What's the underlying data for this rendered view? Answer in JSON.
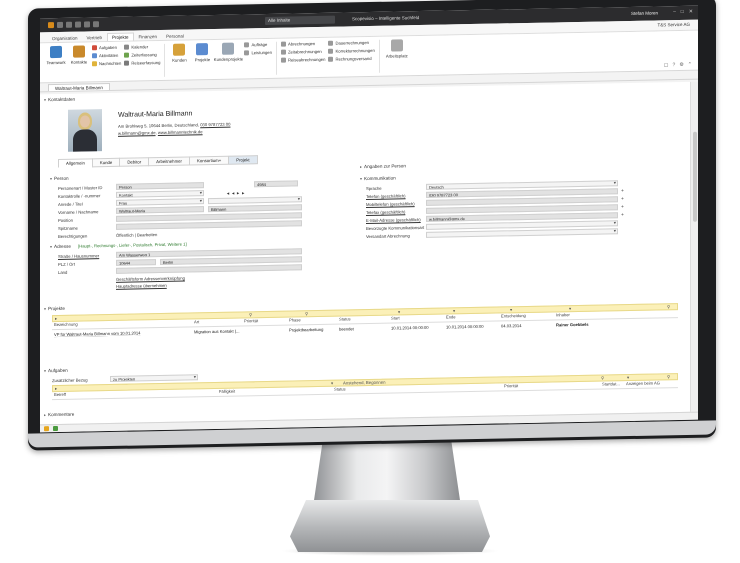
{
  "titlebar": {
    "search_placeholder": "Alle Inhalte",
    "app_title": "Scopevisio – Intelligente Suchfeld",
    "user": "Stefan Moren"
  },
  "ribbon_tabs": [
    "Organisation",
    "Vertrieb",
    "Projekte",
    "Finanzen",
    "Personal"
  ],
  "company": "T&S Service AG",
  "ribbon": {
    "teamwork": "Teamwork",
    "kontakte": "Kontakte",
    "aufgaben": "Aufgaben",
    "aktivitaeten": "Aktivitäten",
    "nachrichten": "Nachrichten",
    "kalender": "Kalender",
    "zeiterfassung": "Zeiterfassung",
    "reiseerfassung": "Reiseerfassung",
    "kunden": "Kunden",
    "projekte": "Projekte",
    "kundenprojekte": "Kundenprojekte",
    "auftraege": "Aufträge",
    "leistungen": "Leistungen",
    "abrechnungen": "Abrechnungen",
    "zeitabrechnungen": "Zeitabrechnungen",
    "reiseabrechnungen": "Reiseabrechnungen",
    "dauerrechnungen": "Dauerrechnungen",
    "korrekturrechnungen": "Korrekturrechnungen",
    "rechnungsversand": "Rechnungsversand",
    "arbeitsplatz": "Arbeitsplatz"
  },
  "doc_tab": "Waltraut-Maria Billmann",
  "contact": {
    "section": "Kontaktdaten",
    "name": "Waltraut-Maria Billmann",
    "address": "Am Brohlweg 5, 10644 Berlin, Deutschland,",
    "phone": "030 9787723 00",
    "email": "w.billmann@gmx.de",
    "web": "www.billmanntechnik.de"
  },
  "subtabs": [
    "Allgemein",
    "Kunde",
    "Debitor",
    "Arbeitnehmer",
    "Konsortium+",
    "Projekt"
  ],
  "person": {
    "section": "Person",
    "rows": [
      {
        "label": "Personenart / Muster ID",
        "value": "Person",
        "value2": "4984"
      },
      {
        "label": "Kontaktrolle / -nummer",
        "value": "Kontakt",
        "value2": "◄ ◄ ► ►"
      },
      {
        "label": "Anrede / Titel",
        "value": "Frau",
        "value2": ""
      },
      {
        "label": "Vorname / Nachname",
        "value": "Waltraut-Maria",
        "value2": "Billmann"
      },
      {
        "label": "Position",
        "value": "",
        "value2": ""
      },
      {
        "label": "Spitzname",
        "value": "",
        "value2": ""
      },
      {
        "label": "Berechtigungen",
        "value": "Öffentlich | Bearbeiten",
        "value2": ""
      }
    ]
  },
  "adresse": {
    "section": "Adresse",
    "tags": "[Haupt-, Rechnungs-, Liefer-, Postalisch, Privat, Weitere 1]",
    "rows": [
      {
        "label": "Straße / Hausnummer",
        "value": "Am Wasserweg 1",
        "value2": ""
      },
      {
        "label": "PLZ / Ort",
        "value": "10644",
        "value2": "Berlin"
      },
      {
        "label": "Land",
        "value": "",
        "value2": ""
      }
    ],
    "link1": "Geschäftsform Adressenverknüpfung",
    "link2": "Hauptadresse übernehmen"
  },
  "angaben": "Angaben zur Person",
  "kommunikation": {
    "section": "Kommunikation",
    "rows": [
      {
        "label": "Sprache",
        "value": "Deutsch",
        "plus": ""
      },
      {
        "label": "Telefon (geschäftlich)",
        "value": "030 9787723 00",
        "plus": "+"
      },
      {
        "label": "Mobiltelefon (geschäftlich)",
        "value": "",
        "plus": "+"
      },
      {
        "label": "Telefax (geschäftlich)",
        "value": "",
        "plus": "+"
      },
      {
        "label": "E-Mail-Adresse (geschäftlich)",
        "value": "w.billmann@gmx.de",
        "plus": "+"
      },
      {
        "label": "Bevorzugte Kommunikationsart",
        "value": "",
        "plus": ""
      },
      {
        "label": "Versandart Abrechnung",
        "value": "",
        "plus": ""
      }
    ]
  },
  "projekte": {
    "section": "Projekte",
    "headers": [
      "Bezeichnung",
      "Art",
      "Priorität",
      "Phase",
      "Status",
      "Start",
      "Ende",
      "Entscheidung",
      "Inhaber"
    ],
    "rows": [
      [
        "VP für Waltraut-Maria Billmann vom 10.01.2014",
        "Migration aus Kontakt (...",
        "",
        "Projektbearbeitung",
        "beendet",
        "10.01.2014 00:00:00",
        "10.01.2014 00:00:00",
        "04.03.2014",
        "Rainer Goebbels"
      ]
    ]
  },
  "aufgaben": {
    "section": "Aufgaben",
    "zusaetzlicher_bezug_label": "Zusätzlicher Bezug",
    "zusaetzlicher_bezug_value": "zu Projekten",
    "filter_status": "Anstehend, Begonnen",
    "headers": [
      "Betreff",
      "Fälligkeit",
      "Status",
      "Priorität",
      "Startdat...",
      "Anzeigen beim AG"
    ]
  },
  "kommentare": "Kommentare"
}
